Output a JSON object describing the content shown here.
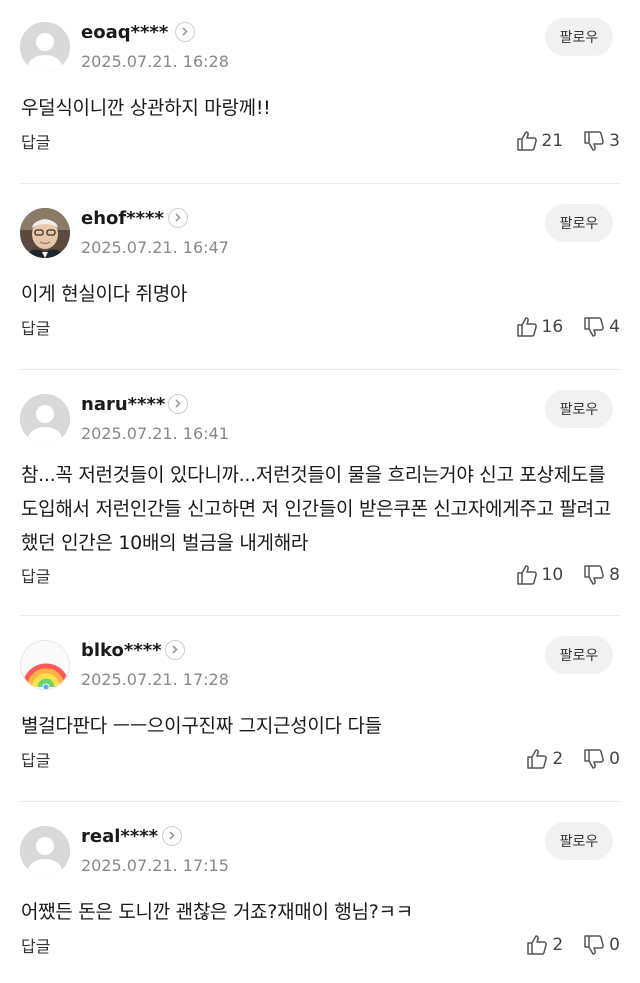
{
  "follow_label": "팔로우",
  "reply_label": "답글",
  "comments": [
    {
      "username": "eoaq****",
      "date": "2025.07.21. 16:28",
      "text": "우덜식이니깐 상관하지 마랑께!!",
      "likes": "21",
      "dislikes": "3",
      "avatar_icon": "default-avatar-icon"
    },
    {
      "username": "ehof****",
      "date": "2025.07.21. 16:47",
      "text": "이게 현실이다 쥐명아",
      "likes": "16",
      "dislikes": "4",
      "avatar_icon": "photo-avatar-icon"
    },
    {
      "username": "naru****",
      "date": "2025.07.21. 16:41",
      "text": "참...꼭 저런것들이 있다니까...저런것들이 물을 흐리는거야 신고 포상제도를 도입해서 저런인간들 신고하면 저 인간들이 받은쿠폰 신고자에게주고 팔려고 했던 인간은 10배의 벌금을 내게해라",
      "likes": "10",
      "dislikes": "8",
      "avatar_icon": "default-avatar-icon"
    },
    {
      "username": "blko****",
      "date": "2025.07.21. 17:28",
      "text": "별걸다판다 ㅡㅡ으이구진짜 그지근성이다 다들",
      "likes": "2",
      "dislikes": "0",
      "avatar_icon": "rainbow-avatar-icon"
    },
    {
      "username": "real****",
      "date": "2025.07.21. 17:15",
      "text": "어쨌든 돈은 도니깐 괜찮은 거죠?재매이 행님?ㅋㅋ",
      "likes": "2",
      "dislikes": "0",
      "avatar_icon": "default-avatar-icon"
    }
  ]
}
